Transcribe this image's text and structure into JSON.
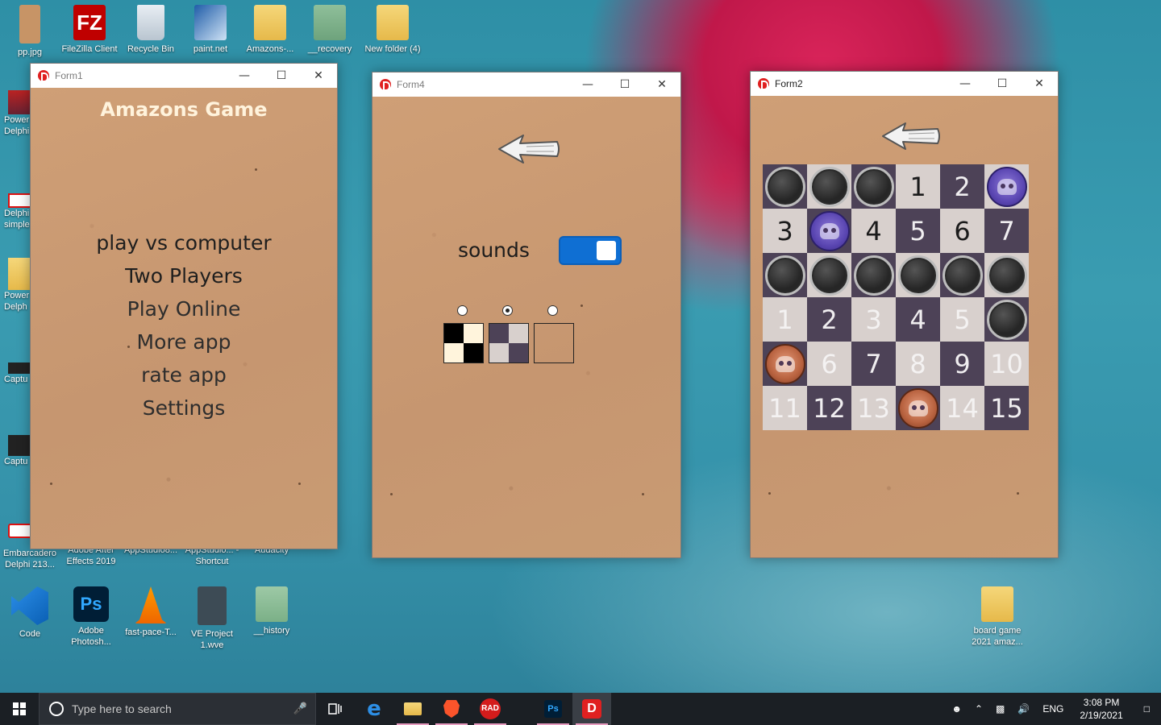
{
  "desktop": {
    "top_icons": [
      {
        "label": "pp.jpg"
      },
      {
        "label": "FileZilla Client"
      },
      {
        "label": "Recycle Bin"
      },
      {
        "label": "paint.net"
      },
      {
        "label": "Amazons-..."
      },
      {
        "label": "__recovery"
      },
      {
        "label": "New folder (4)"
      }
    ],
    "left_icons": [
      {
        "label": "Power Delphi"
      },
      {
        "label": "Delphi simple"
      },
      {
        "label": "Power Delph"
      },
      {
        "label": "Captu"
      },
      {
        "label": "Captu"
      }
    ],
    "row2_icons": [
      {
        "label": "Embarcadero Delphi 213..."
      },
      {
        "label": "Adobe After Effects 2019"
      },
      {
        "label": "AppStudio8..."
      },
      {
        "label": "AppStudio... - Shortcut"
      },
      {
        "label": "Audacity"
      }
    ],
    "bottom_icons": [
      {
        "label": "Code"
      },
      {
        "label": "Adobe Photosh..."
      },
      {
        "label": "fast-pace-T..."
      },
      {
        "label": "VE Project 1.wve"
      },
      {
        "label": "__history"
      }
    ],
    "right_icon": {
      "label": "board game 2021 amaz..."
    }
  },
  "form1": {
    "title": "Form1",
    "game_title": "Amazons Game",
    "menu": [
      "play vs computer",
      "Two Players",
      "Play Online",
      "More app",
      "rate app",
      "Settings"
    ]
  },
  "form4": {
    "title": "Form4",
    "sounds_label": "sounds",
    "sounds_on": true,
    "selected_theme_index": 1
  },
  "form2": {
    "title": "Form2",
    "board": [
      [
        {
          "t": "dark",
          "p": "stone"
        },
        {
          "t": "light",
          "p": "stone"
        },
        {
          "t": "dark",
          "p": "stone"
        },
        {
          "t": "light",
          "n": "1"
        },
        {
          "t": "dark",
          "n": "2"
        },
        {
          "t": "light",
          "p": "blue"
        }
      ],
      [
        {
          "t": "light",
          "n": "3"
        },
        {
          "t": "dark",
          "p": "blue"
        },
        {
          "t": "light",
          "n": "4"
        },
        {
          "t": "dark",
          "n": "5"
        },
        {
          "t": "light",
          "n": "6"
        },
        {
          "t": "dark",
          "n": "7"
        }
      ],
      [
        {
          "t": "dark",
          "p": "stone"
        },
        {
          "t": "light",
          "p": "stone"
        },
        {
          "t": "dark",
          "p": "stone"
        },
        {
          "t": "light",
          "p": "stone"
        },
        {
          "t": "dark",
          "p": "stone"
        },
        {
          "t": "light",
          "p": "stone"
        }
      ],
      [
        {
          "t": "light",
          "n": "1",
          "f": true
        },
        {
          "t": "dark",
          "n": "2"
        },
        {
          "t": "light",
          "n": "3",
          "f": true
        },
        {
          "t": "dark",
          "n": "4"
        },
        {
          "t": "light",
          "n": "5",
          "f": true
        },
        {
          "t": "dark",
          "p": "stone"
        }
      ],
      [
        {
          "t": "dark",
          "p": "copper"
        },
        {
          "t": "light",
          "n": "6",
          "f": true
        },
        {
          "t": "dark",
          "n": "7"
        },
        {
          "t": "light",
          "n": "8",
          "f": true
        },
        {
          "t": "dark",
          "n": "9"
        },
        {
          "t": "light",
          "n": "10",
          "f": true
        }
      ],
      [
        {
          "t": "light",
          "n": "11",
          "f": true
        },
        {
          "t": "dark",
          "n": "12"
        },
        {
          "t": "light",
          "n": "13",
          "f": true
        },
        {
          "t": "dark",
          "p": "copper"
        },
        {
          "t": "light",
          "n": "14",
          "f": true
        },
        {
          "t": "dark",
          "n": "15"
        }
      ]
    ]
  },
  "taskbar": {
    "search_placeholder": "Type here to search",
    "rad_label": "RAD",
    "ps_label": "Ps",
    "language": "ENG",
    "time": "3:08 PM",
    "date": "2/19/2021"
  },
  "colors": {
    "board_light": "#d8d0cd",
    "board_dark": "#4d4257",
    "toggle_on": "#0f6fd3",
    "paper": "#c99a72"
  }
}
